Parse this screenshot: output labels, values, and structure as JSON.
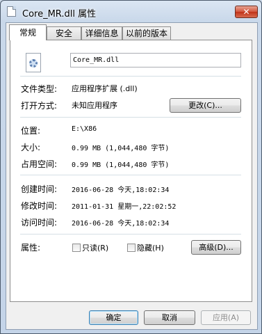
{
  "window": {
    "title": "Core_MR.dll 属性",
    "close_label": "✕"
  },
  "tabs": [
    {
      "label": "常规",
      "active": true
    },
    {
      "label": "安全",
      "active": false
    },
    {
      "label": "详细信息",
      "active": false
    },
    {
      "label": "以前的版本",
      "active": false
    }
  ],
  "general": {
    "file_name": "Core_MR.dll",
    "file_type_label": "文件类型:",
    "file_type_value": "应用程序扩展 (.dll)",
    "open_with_label": "打开方式:",
    "open_with_value": "未知应用程序",
    "change_button": "更改(C)...",
    "location_label": "位置:",
    "location_value": "E:\\X86",
    "size_label": "大小:",
    "size_value": "0.99 MB (1,044,480 字节)",
    "disk_size_label": "占用空间:",
    "disk_size_value": "0.99 MB (1,044,480 字节)",
    "created_label": "创建时间:",
    "created_value": "2016-06-28 今天,18:02:34",
    "modified_label": "修改时间:",
    "modified_value": "2011-01-31 星期一,22:02:52",
    "accessed_label": "访问时间:",
    "accessed_value": "2016-06-28 今天,18:02:34",
    "attributes_label": "属性:",
    "readonly_label": "只读(R)",
    "readonly_checked": false,
    "hidden_label": "隐藏(H)",
    "hidden_checked": false,
    "advanced_button": "高级(D)..."
  },
  "footer": {
    "ok_button": "确定",
    "cancel_button": "取消",
    "apply_button": "应用(A)"
  },
  "icons": {
    "title": "dll-file-icon",
    "file": "dll-gear-file-icon"
  }
}
